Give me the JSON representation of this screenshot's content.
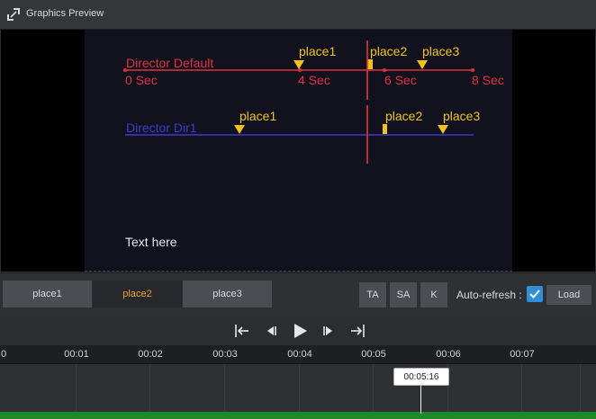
{
  "window": {
    "title": "Graphics Preview"
  },
  "preview": {
    "text_here": "Text here",
    "default_track": {
      "label": "Director Default",
      "color": "#e0323c",
      "time_labels": [
        "0 Sec",
        "4 Sec",
        "6 Sec",
        "8 Sec"
      ],
      "markers": [
        "place1",
        "place2",
        "place3"
      ]
    },
    "dir1_track": {
      "label": "Director Dir1",
      "color": "#3a3ad0",
      "markers": [
        "place1",
        "place2",
        "place3"
      ]
    },
    "marker_color": "#f2c21a"
  },
  "place_buttons": [
    "place1",
    "place2",
    "place3"
  ],
  "active_place": "place2",
  "square_buttons": [
    "TA",
    "SA",
    "K"
  ],
  "auto_refresh": {
    "label": "Auto-refresh :",
    "checked": true
  },
  "load_label": "Load",
  "timeline": {
    "ticks": [
      "0",
      "00:01",
      "00:02",
      "00:03",
      "00:04",
      "00:05",
      "00:06",
      "00:07"
    ],
    "playhead_time": "00:05:16"
  },
  "colors": {
    "accent": "#f0a030",
    "checkbox": "#2f8fd8",
    "progress": "#1f8a2a"
  }
}
